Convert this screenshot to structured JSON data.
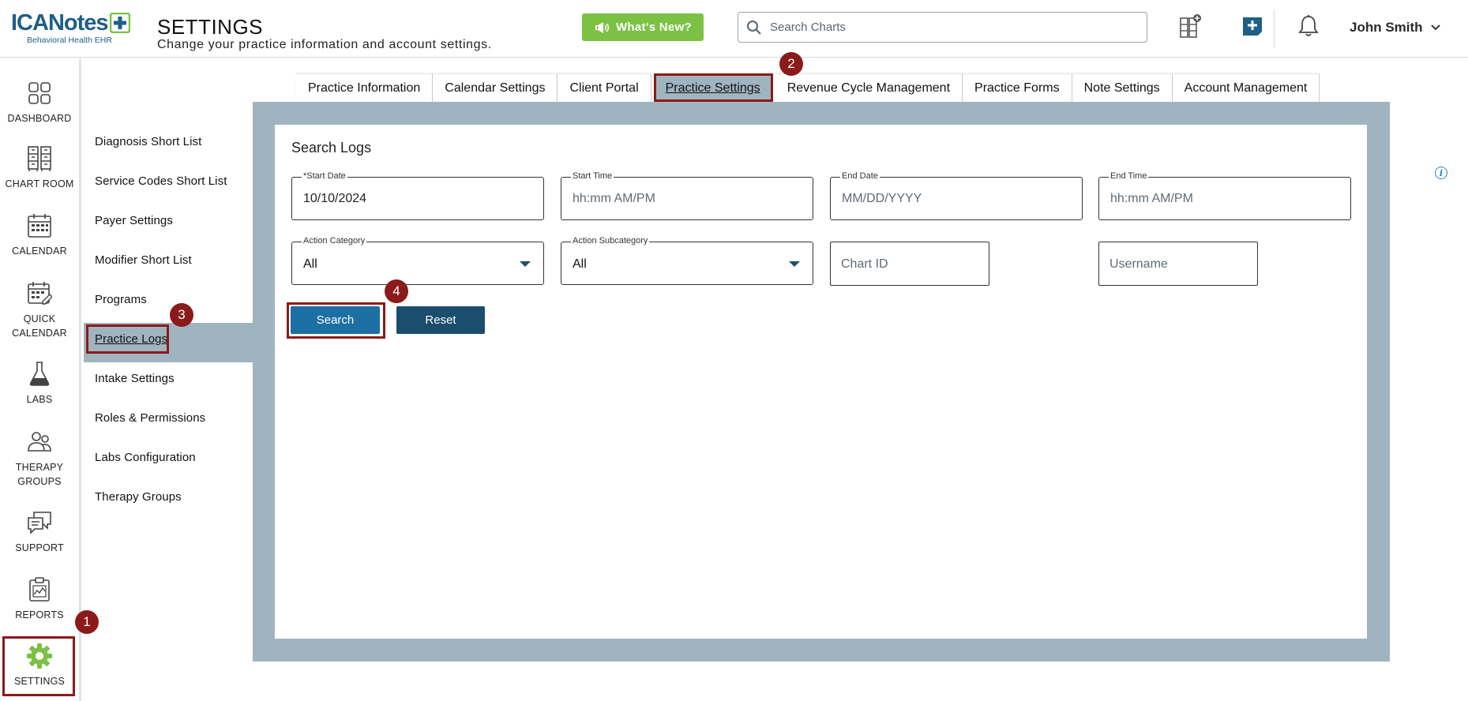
{
  "app": {
    "logo_text_ica": "ICA",
    "logo_text_notes": "Notes",
    "logo_subtitle": "Behavioral Health EHR",
    "page_title": "SETTINGS",
    "page_subtitle": "Change your practice information and account settings.",
    "whats_new_label": "What's New?",
    "search_placeholder": "Search Charts",
    "user_name": "John Smith"
  },
  "leftnav": {
    "items": [
      {
        "label": "DASHBOARD",
        "icon": "dashboard-icon"
      },
      {
        "label": "CHART ROOM",
        "icon": "chart-room-icon"
      },
      {
        "label": "CALENDAR",
        "icon": "calendar-icon"
      },
      {
        "label": "QUICK\nCALENDAR",
        "icon": "quick-calendar-icon"
      },
      {
        "label": "LABS",
        "icon": "labs-icon"
      },
      {
        "label": "THERAPY\nGROUPS",
        "icon": "therapy-groups-icon"
      },
      {
        "label": "SUPPORT",
        "icon": "support-icon"
      },
      {
        "label": "REPORTS",
        "icon": "reports-icon"
      },
      {
        "label": "SETTINGS",
        "icon": "settings-gear-icon"
      }
    ]
  },
  "subnav": {
    "items": [
      {
        "label": "Diagnosis Short List"
      },
      {
        "label": "Service Codes Short List"
      },
      {
        "label": "Payer Settings"
      },
      {
        "label": "Modifier Short List"
      },
      {
        "label": "Programs"
      },
      {
        "label": "Practice Logs",
        "active": true
      },
      {
        "label": "Intake Settings"
      },
      {
        "label": "Roles & Permissions"
      },
      {
        "label": "Labs Configuration"
      },
      {
        "label": "Therapy Groups"
      }
    ]
  },
  "tabs": [
    {
      "label": "Practice Information"
    },
    {
      "label": "Calendar Settings"
    },
    {
      "label": "Client Portal"
    },
    {
      "label": "Practice Settings",
      "active": true
    },
    {
      "label": "Revenue Cycle Management"
    },
    {
      "label": "Practice Forms"
    },
    {
      "label": "Note Settings"
    },
    {
      "label": "Account Management"
    }
  ],
  "search_logs": {
    "title": "Search Logs",
    "start_date": {
      "label": "*Start Date",
      "value": "10/10/2024"
    },
    "start_time": {
      "label": "Start Time",
      "placeholder": "hh:mm AM/PM"
    },
    "end_date": {
      "label": "End Date",
      "placeholder": "MM/DD/YYYY"
    },
    "end_time": {
      "label": "End Time",
      "placeholder": "hh:mm AM/PM"
    },
    "action_category": {
      "label": "Action Category",
      "value": "All"
    },
    "action_subcategory": {
      "label": "Action Subcategory",
      "value": "All"
    },
    "chart_id": {
      "placeholder": "Chart ID"
    },
    "username": {
      "placeholder": "Username"
    },
    "search_button": "Search",
    "reset_button": "Reset"
  },
  "steps": [
    "1",
    "2",
    "3",
    "4"
  ],
  "colors": {
    "brand_blue": "#1e5f86",
    "whats_new_green": "#7bc143",
    "highlight_red": "#8b1a1a",
    "panel_frame": "#a0b4c0",
    "search_button": "#1c6fa3",
    "reset_button": "#1b4d6e"
  }
}
